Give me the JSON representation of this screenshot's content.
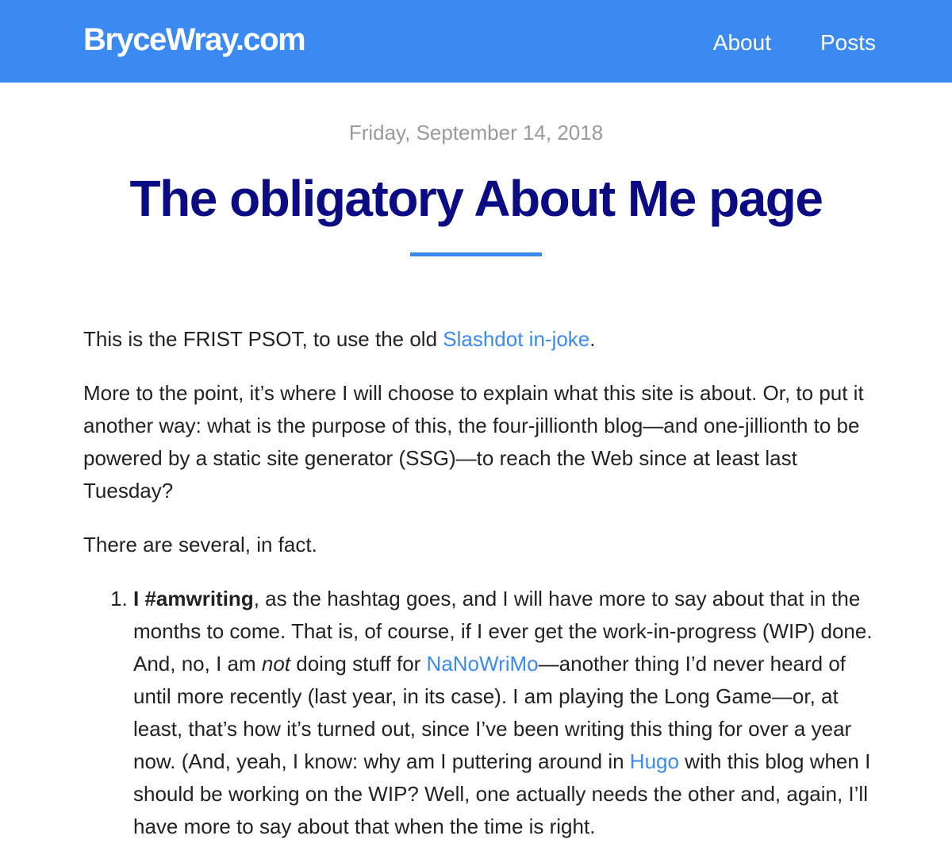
{
  "header": {
    "site_title": "BryceWray.com",
    "nav": [
      {
        "label": "About"
      },
      {
        "label": "Posts"
      }
    ],
    "background_color": "#3b8af2"
  },
  "post": {
    "date": "Friday, September 14, 2018",
    "title": "The obligatory About Me page",
    "title_color": "#0b0c83",
    "paragraph_1": {
      "before": "This is the FRIST PSOT, to use the old ",
      "link": "Slashdot in-joke",
      "after": "."
    },
    "paragraph_2": "More to the point, it’s where I will choose to explain what this site is about. Or, to put it another way: what is the purpose of this, the four-jillionth blog—and one-jillionth to be powered by a static site generator (SSG)—to reach the Web since at least last Tuesday?",
    "paragraph_3": "There are several, in fact.",
    "list_item_1": {
      "bold": "I #amwriting",
      "text_1": ", as the hashtag goes, and I will have more to say about that in the months to come. That is, of course, if I ever get the work-in-progress (WIP) done. And, no, I am ",
      "emphasis": "not",
      "text_2": " doing stuff for ",
      "link_1": "NaNoWriMo",
      "text_3": "—another thing I’d never heard of until more recently (last year, in its case). I am playing the Long Game—or, at least, that’s how it’s turned out, since I’ve been writing this thing for over a year now. (And, yeah, I know: why am I puttering around in ",
      "link_2": "Hugo",
      "text_4": " with this blog when I should be working on the WIP? Well, one actually needs the other and, again, I’ll have more to say about that when the time is right."
    }
  }
}
